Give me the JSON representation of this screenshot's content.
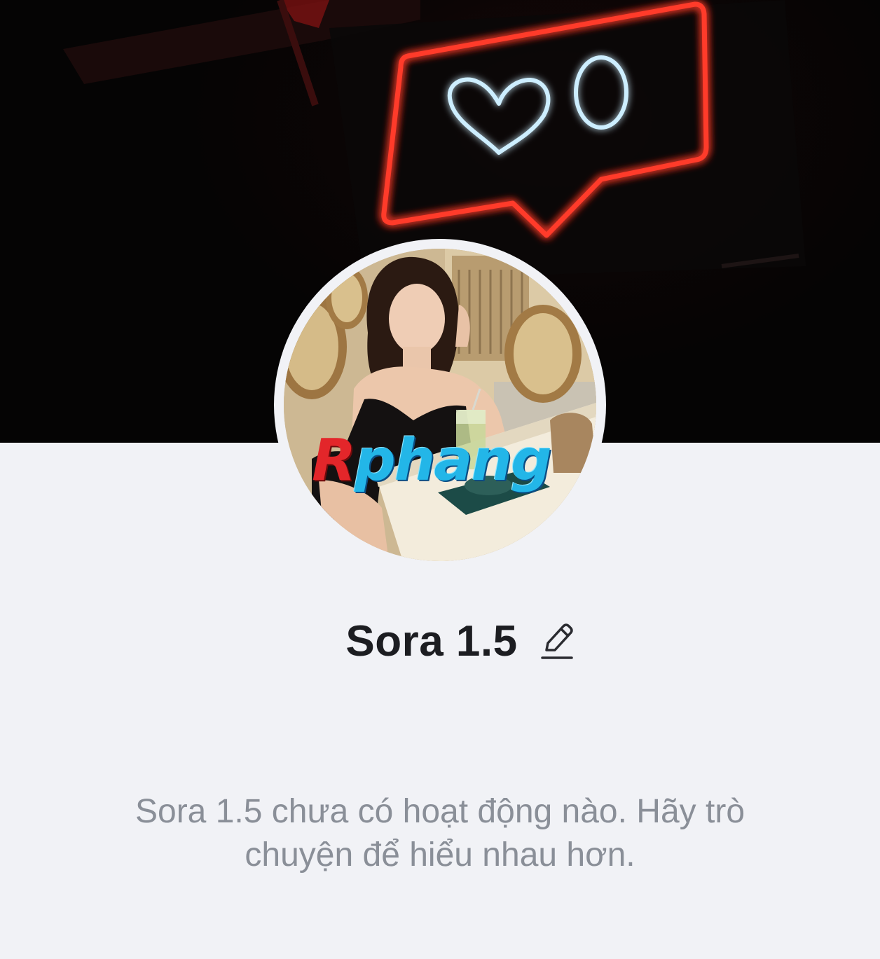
{
  "cover": {
    "description_icon": "neon-like-sign-icon",
    "accent_red": "#ff3b2a",
    "accent_blue": "#bfe9ff"
  },
  "avatar": {
    "watermark_first": "R",
    "watermark_rest": "phang"
  },
  "profile": {
    "name": "Sora 1.5",
    "edit_icon": "pencil-edit-icon"
  },
  "empty_state": {
    "line1": "Sora 1.5 chưa có hoạt động nào. Hãy trò",
    "line2": "chuyện để hiểu nhau hơn."
  }
}
